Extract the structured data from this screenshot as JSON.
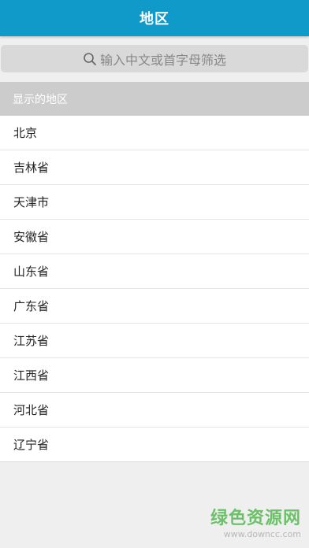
{
  "header": {
    "title": "地区"
  },
  "search": {
    "placeholder": "输入中文或首字母筛选",
    "icon": "search-icon"
  },
  "section": {
    "header": "显示的地区"
  },
  "regions": [
    {
      "label": "北京"
    },
    {
      "label": "吉林省"
    },
    {
      "label": "天津市"
    },
    {
      "label": "安徽省"
    },
    {
      "label": "山东省"
    },
    {
      "label": "广东省"
    },
    {
      "label": "江苏省"
    },
    {
      "label": "江西省"
    },
    {
      "label": "河北省"
    },
    {
      "label": "辽宁省"
    }
  ],
  "watermark": {
    "text": "绿色资源网",
    "url": "www.downcc.com"
  },
  "colors": {
    "title_bar": "#0f9ac9",
    "search_box": "#d9d9d9",
    "section_header": "#cccccc",
    "background": "#efefef",
    "watermark": "#6dc06a"
  }
}
